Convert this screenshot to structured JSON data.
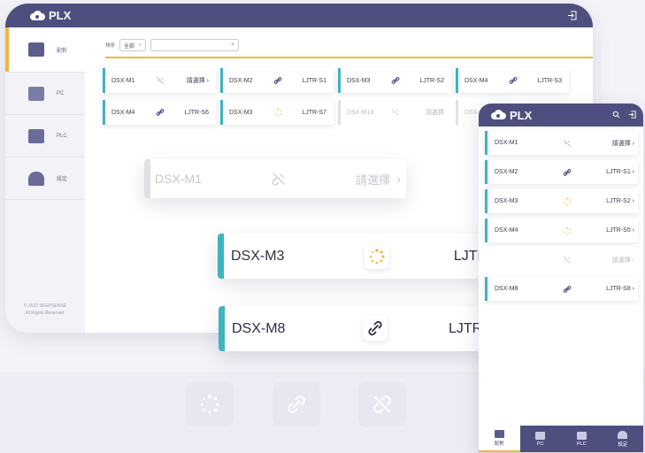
{
  "app": {
    "name": "PLX"
  },
  "tablet": {
    "sidebar": [
      {
        "label": "配對",
        "active": true,
        "icon": "link-screen-icon"
      },
      {
        "label": "PC",
        "active": false,
        "icon": "pc-icon"
      },
      {
        "label": "PLC",
        "active": false,
        "icon": "plc-icon"
      },
      {
        "label": "設定",
        "active": false,
        "icon": "settings-icon"
      }
    ],
    "copyright": [
      "© 2022 DEEPSENSE",
      "All Rights Reserved."
    ],
    "filter": {
      "label": "排序",
      "select_value": "全部",
      "search_placeholder": ""
    },
    "cards": [
      {
        "name": "DSX-M1",
        "icon": "unlink-icon",
        "target": "請選擇 ›",
        "state": "unlinked"
      },
      {
        "name": "DSX-M2",
        "icon": "link-icon",
        "target": "LJTR-S1",
        "state": "linked"
      },
      {
        "name": "DSX-M3",
        "icon": "link-icon",
        "target": "LJTR-S2",
        "state": "linked"
      },
      {
        "name": "DSX-M4",
        "icon": "link-icon",
        "target": "LJTR-S3",
        "state": "linked"
      },
      {
        "name": "DSX-M4",
        "icon": "link-icon",
        "target": "LJTR-S6",
        "state": "linked"
      },
      {
        "name": "DSX-M3",
        "icon": "loading-icon",
        "target": "LJTR-S7",
        "state": "loading"
      },
      {
        "name": "DSX-M13",
        "icon": "unlink-icon",
        "target": "請選擇",
        "state": "disabled"
      },
      {
        "name": "DSX-",
        "icon": "none",
        "target": "",
        "state": "disabled"
      }
    ]
  },
  "floating": [
    {
      "name": "DSX-M1",
      "target": "請選擇",
      "state": "disabled"
    },
    {
      "name": "DSX-M3",
      "target": "LJTR-S2",
      "state": "loading"
    },
    {
      "name": "DSX-M8",
      "target": "LJTR",
      "state": "linked"
    }
  ],
  "phone": {
    "cards": [
      {
        "name": "DSX-M1",
        "icon": "unlink-icon",
        "target": "請選擇 ›",
        "state": "unlinked"
      },
      {
        "name": "DSX-M2",
        "icon": "link-icon",
        "target": "LJTR-S1 ›",
        "state": "linked"
      },
      {
        "name": "DSX-M3",
        "icon": "loading-icon",
        "target": "LJTR-S2 ›",
        "state": "loading"
      },
      {
        "name": "DSX-M4",
        "icon": "loading-icon",
        "target": "LJTR-S5 ›",
        "state": "loading"
      },
      {
        "name": "",
        "icon": "unlink-icon",
        "target": "請選擇 ›",
        "state": "disabled"
      },
      {
        "name": "DSX-M8",
        "icon": "link-icon",
        "target": "LJTR-S8 ›",
        "state": "linked"
      }
    ],
    "tabs": [
      {
        "label": "配對",
        "active": true
      },
      {
        "label": "PC",
        "active": false
      },
      {
        "label": "PLC",
        "active": false
      },
      {
        "label": "設定",
        "active": false
      }
    ]
  },
  "colors": {
    "header": "#4e4f7f",
    "accent": "#f0b73a",
    "teal": "#3bb5c0"
  }
}
